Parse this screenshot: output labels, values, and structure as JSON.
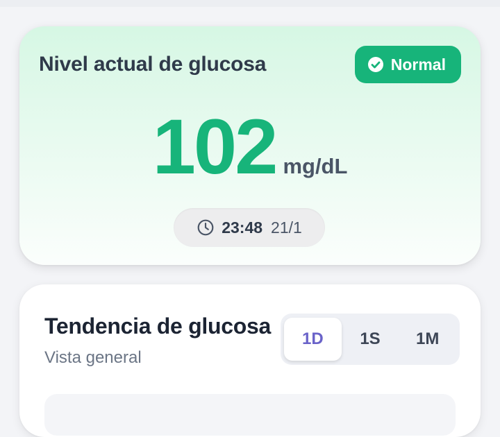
{
  "current": {
    "title": "Nivel actual de glucosa",
    "status": {
      "label": "Normal",
      "icon": "check-circle-icon",
      "color": "#17b47a"
    },
    "value": "102",
    "unit": "mg/dL",
    "time": "23:48",
    "date": "21/1"
  },
  "trend": {
    "title": "Tendencia de glucosa",
    "subtitle": "Vista general",
    "ranges": [
      {
        "label": "1D",
        "active": true
      },
      {
        "label": "1S",
        "active": false
      },
      {
        "label": "1M",
        "active": false
      }
    ],
    "active_color": "#6a63c9"
  }
}
